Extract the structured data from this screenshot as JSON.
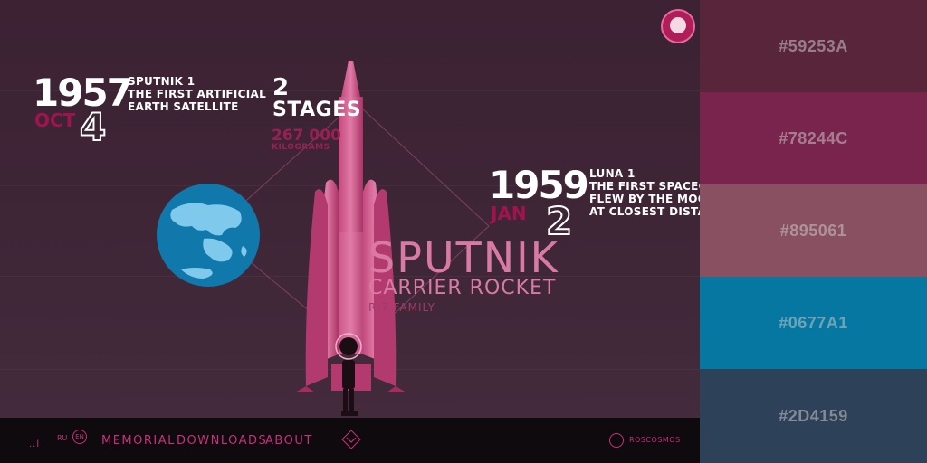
{
  "event1957": {
    "year": "1957",
    "month": "OCT",
    "day": "4",
    "caption_line1": "SPUTNIK 1",
    "caption_line2": "THE FIRST ARTIFICIAL",
    "caption_line3": "EARTH SATELLITE"
  },
  "stages": {
    "count": "2",
    "label": "STAGES",
    "mass": "267 000",
    "mass_unit": "KILOGRAMS"
  },
  "event1959": {
    "year": "1959",
    "month": "JAN",
    "day": "2",
    "caption_line1": "LUNA 1",
    "caption_line2": "THE FIRST SPACECR",
    "caption_line3": "FLEW BY THE MOO",
    "caption_line4": "AT CLOSEST DISTAN"
  },
  "rocket": {
    "title": "SPUTNIK",
    "subtitle": "CARRIER ROCKET",
    "family": "R-7 FAMILY"
  },
  "bottom_nav": {
    "bars": "..l",
    "lang_ru": "RU",
    "lang_en": "EN",
    "memorial": "MEMORIAL",
    "downloads": "DOWNLOADS",
    "about": "ABOUT",
    "roscosmos": "ROSCOSMOS"
  },
  "palette": [
    {
      "hex": "#59253A",
      "label": "#59253A"
    },
    {
      "hex": "#78244C",
      "label": "#78244C"
    },
    {
      "hex": "#895061",
      "label": "#895061"
    },
    {
      "hex": "#0677A1",
      "label": "#0677A1"
    },
    {
      "hex": "#2D4159",
      "label": "#2D4159"
    }
  ],
  "icons": {
    "globe": "globe-icon",
    "rocket": "rocket-illustration",
    "astronaut": "astronaut-figure",
    "badge": "gagarin-badge-icon"
  }
}
